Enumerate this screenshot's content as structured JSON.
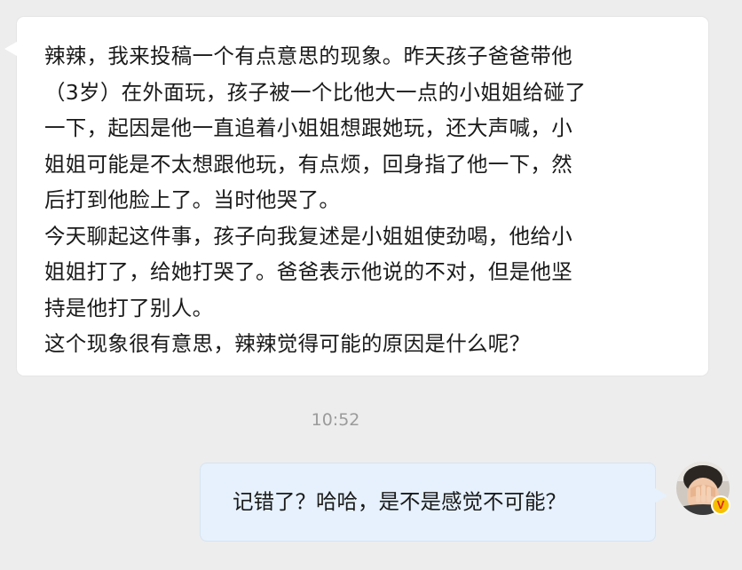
{
  "incoming_message": {
    "lines": [
      "辣辣，我来投稿一个有点意思的现象。昨天孩子爸爸带他",
      "（3岁）在外面玩，孩子被一个比他大一点的小姐姐给碰了",
      "一下，起因是他一直追着小姐姐想跟她玩，还大声喊，小",
      "姐姐可能是不太想跟他玩，有点烦，回身指了他一下，然",
      "后打到他脸上了。当时他哭了。",
      "今天聊起这件事，孩子向我复述是小姐姐使劲喝，他给小",
      "姐姐打了，给她打哭了。爸爸表示他说的不对，但是他坚",
      "持是他打了别人。",
      "这个现象很有意思，辣辣觉得可能的原因是什么呢？"
    ]
  },
  "timestamp": "10:52",
  "outgoing_message": {
    "text": "记错了？哈哈，是不是感觉不可能？"
  },
  "avatar": {
    "icon": "user-avatar",
    "badge": "V",
    "badge_color": "#f6c000"
  },
  "colors": {
    "background": "#ededed",
    "incoming_bubble": "#ffffff",
    "outgoing_bubble": "#e6f1fd"
  }
}
